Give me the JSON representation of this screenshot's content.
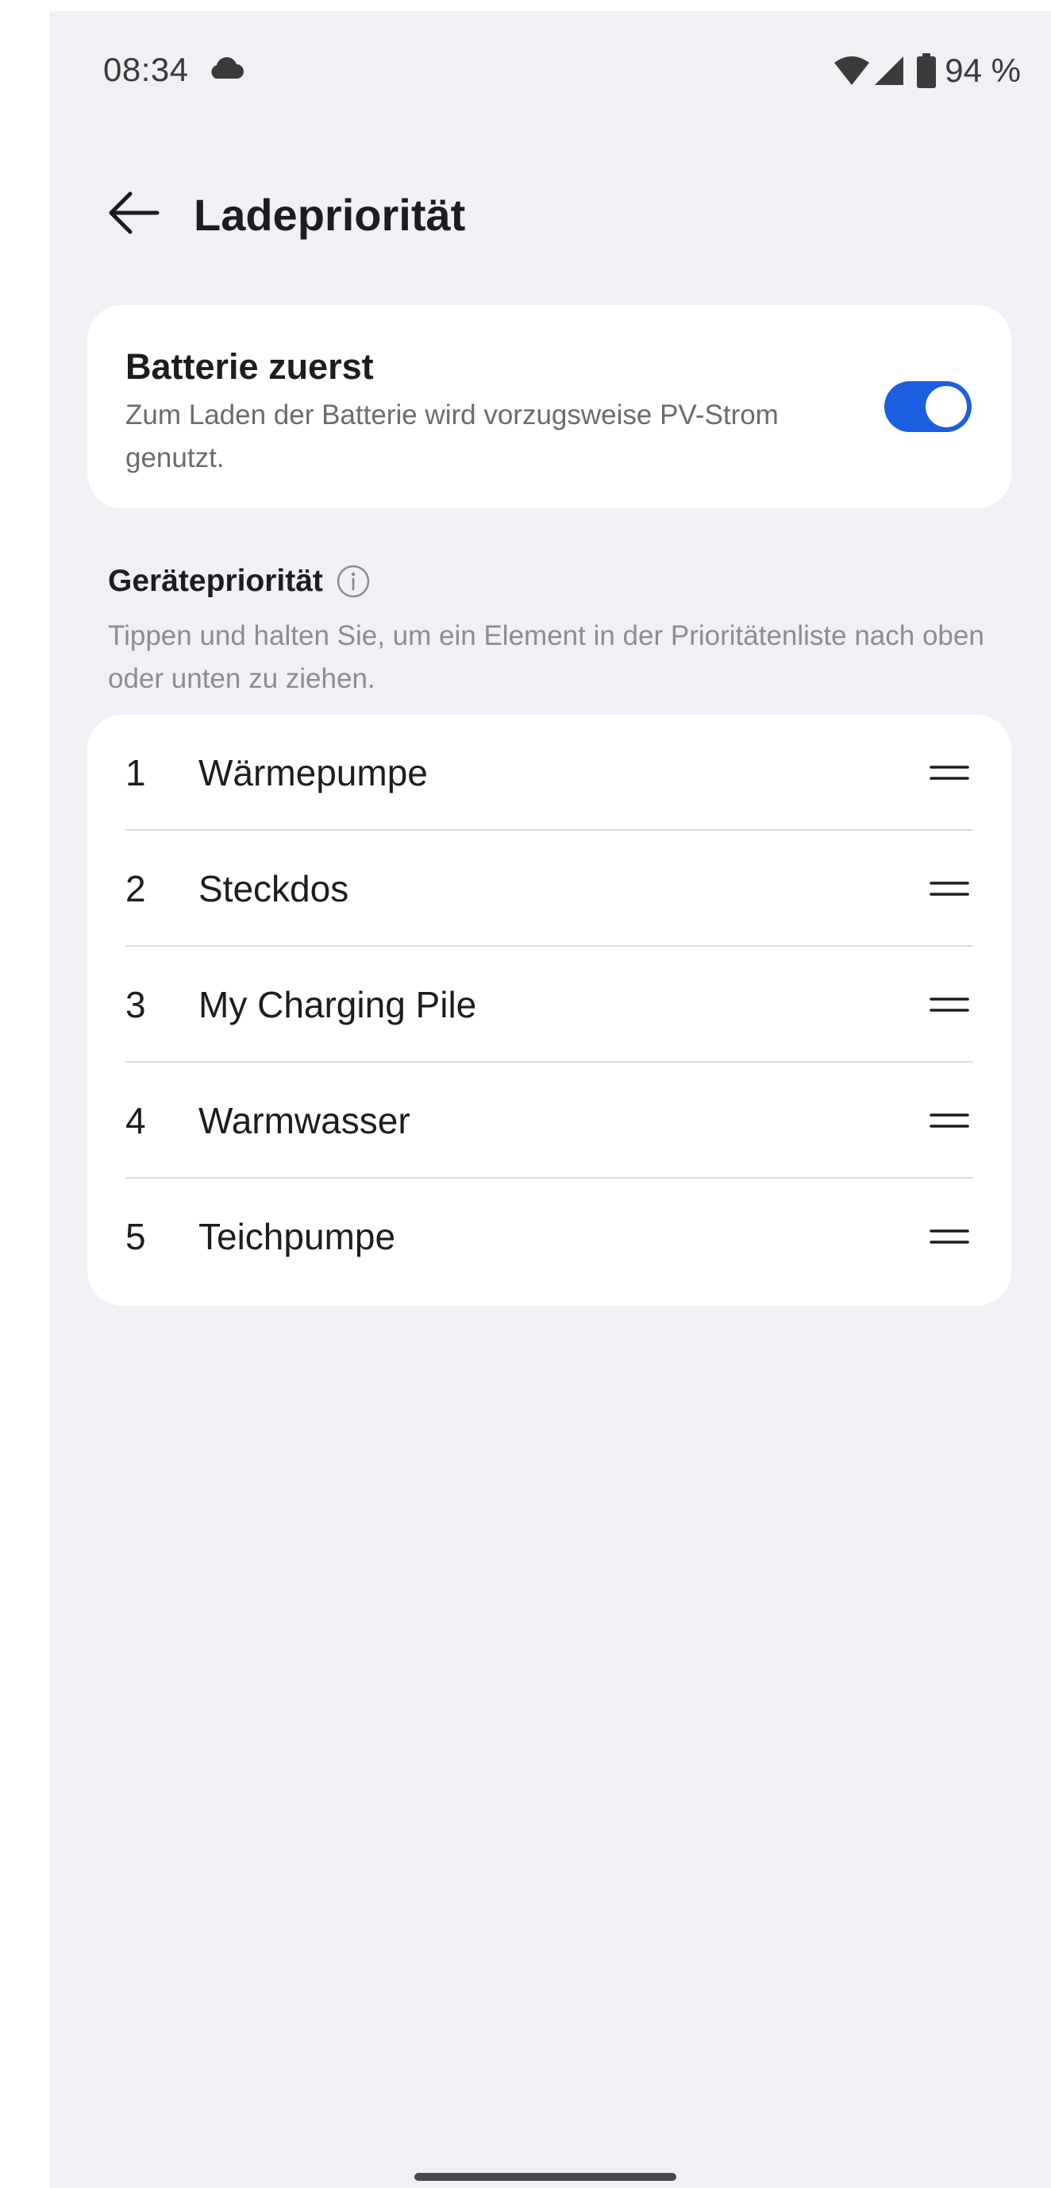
{
  "status_bar": {
    "time": "08:34",
    "battery_percent": "94 %",
    "icons": [
      "cloud-icon",
      "wifi-icon",
      "signal-icon",
      "battery-icon"
    ]
  },
  "header": {
    "title": "Ladepriorität",
    "back_icon": "arrow-left-icon"
  },
  "battery_first": {
    "title": "Batterie zuerst",
    "description": "Zum Laden der Batterie wird vorzugsweise PV-Strom genutzt.",
    "enabled": true,
    "toggle_color": "#1c5fe0"
  },
  "device_priority": {
    "title": "Gerätepriorität",
    "info_icon": "info-icon",
    "description": "Tippen und halten Sie, um ein Element in der Prioritätenliste nach oben oder unten zu ziehen.",
    "items": [
      {
        "index": "1",
        "name": "Wärmepumpe"
      },
      {
        "index": "2",
        "name": "Steckdos"
      },
      {
        "index": "3",
        "name": "My Charging Pile"
      },
      {
        "index": "4",
        "name": "Warmwasser"
      },
      {
        "index": "5",
        "name": "Teichpumpe"
      }
    ]
  },
  "colors": {
    "background": "#f0f1f5",
    "card": "#ffffff",
    "accent": "#1c5fe0"
  }
}
